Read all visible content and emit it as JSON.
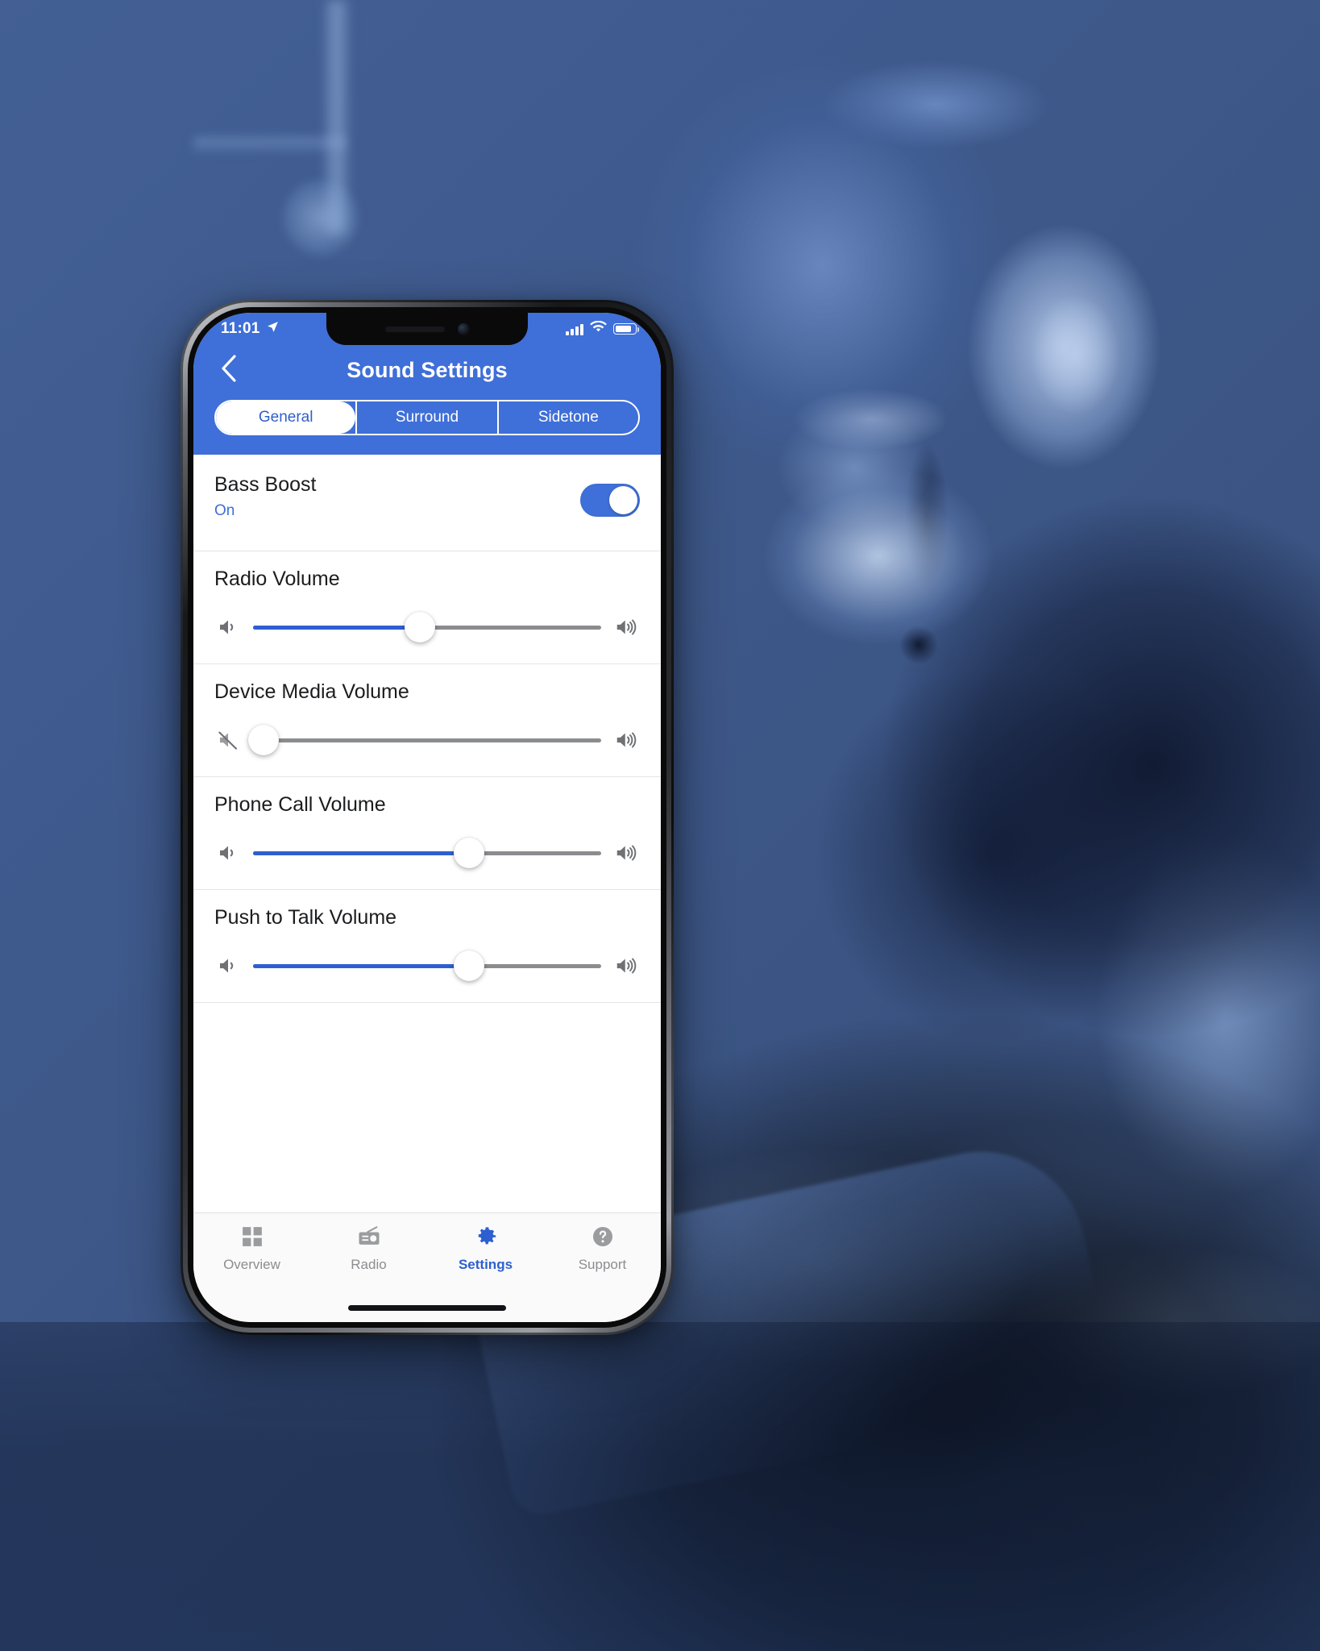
{
  "status_bar": {
    "time": "11:01",
    "location_icon": "location-arrow-icon",
    "signal_icon": "cellular-signal-icon",
    "wifi_icon": "wifi-icon",
    "battery_icon": "battery-icon",
    "battery_level_percent": 82
  },
  "header": {
    "back_icon": "chevron-left-icon",
    "title": "Sound Settings",
    "accent_color": "#3f6fd8"
  },
  "segmented_control": {
    "selected": "General",
    "options": [
      {
        "label": "General",
        "active": true
      },
      {
        "label": "Surround",
        "active": false
      },
      {
        "label": "Sidetone",
        "active": false
      }
    ]
  },
  "settings": {
    "bass_boost": {
      "title": "Bass Boost",
      "value_label": "On",
      "enabled": true,
      "value_color": "#3f6fd8"
    },
    "sliders": [
      {
        "label": "Radio Volume",
        "value_percent": 48,
        "left_icon": "volume-low-icon",
        "right_icon": "volume-high-icon",
        "muted": false
      },
      {
        "label": "Device Media Volume",
        "value_percent": 0,
        "left_icon": "volume-mute-icon",
        "right_icon": "volume-high-icon",
        "muted": true
      },
      {
        "label": "Phone Call Volume",
        "value_percent": 62,
        "left_icon": "volume-low-icon",
        "right_icon": "volume-high-icon",
        "muted": false
      },
      {
        "label": "Push to Talk Volume",
        "value_percent": 62,
        "left_icon": "volume-low-icon",
        "right_icon": "volume-high-icon",
        "muted": false
      }
    ]
  },
  "tab_bar": {
    "active": "Settings",
    "tabs": [
      {
        "label": "Overview",
        "icon": "grid-icon",
        "active": false
      },
      {
        "label": "Radio",
        "icon": "radio-icon",
        "active": false
      },
      {
        "label": "Settings",
        "icon": "gear-icon",
        "active": true
      },
      {
        "label": "Support",
        "icon": "question-circle-icon",
        "active": false
      }
    ]
  },
  "background": {
    "description": "blue duotone photo of worker wearing 3M PELTOR headset using a power tool",
    "tone_color": "#2a4375"
  }
}
